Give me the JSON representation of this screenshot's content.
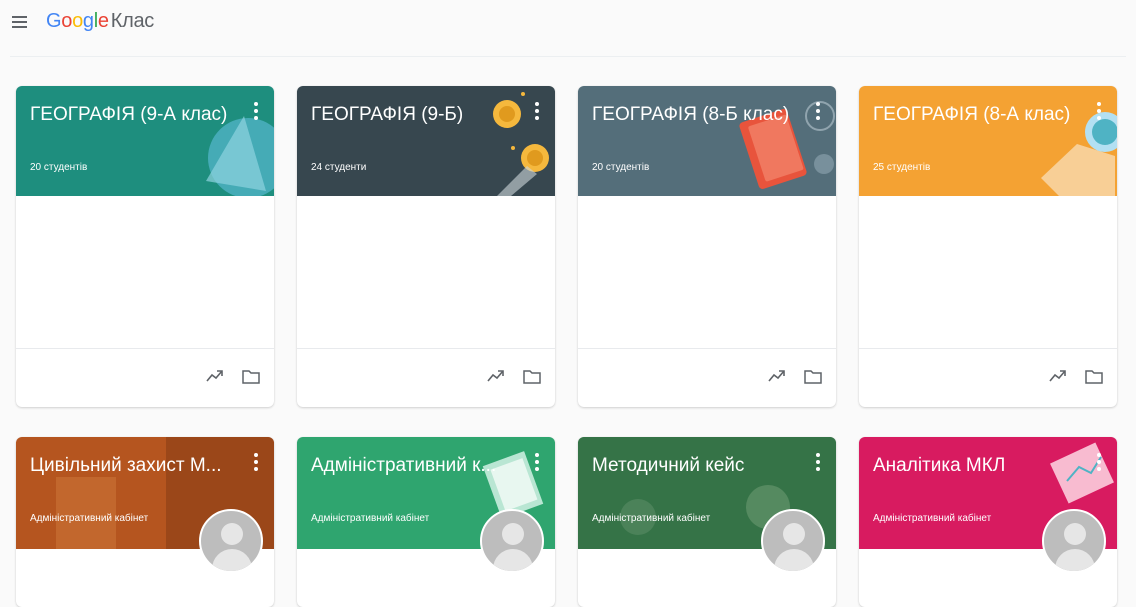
{
  "header": {
    "brand_google": "Google",
    "brand_product": "Клас"
  },
  "row1": [
    {
      "title": "ГЕОГРАФІЯ (9-А клас)",
      "subtitle": "20 студентів",
      "color": "#1e8e7e"
    },
    {
      "title": "ГЕОГРАФІЯ (9-Б)",
      "subtitle": "24 студенти",
      "color": "#37474f"
    },
    {
      "title": "ГЕОГРАФІЯ (8-Б клас)",
      "subtitle": "20 студентів",
      "color": "#546e7a"
    },
    {
      "title": "ГЕОГРАФІЯ (8-А клас)",
      "subtitle": "25 студентів",
      "color": "#f4a233"
    }
  ],
  "row2": [
    {
      "title": "Цивільний захист М...",
      "subtitle": "Адміністративний кабінет",
      "color": "#b5551f"
    },
    {
      "title": "Адміністративний к...",
      "subtitle": "Адміністративний кабінет",
      "color": "#2fa56f"
    },
    {
      "title": "Методичний кейс",
      "subtitle": "Адміністративний кабінет",
      "color": "#3c7a4e"
    },
    {
      "title": "Аналітика МКЛ",
      "subtitle": "Адміністративний кабінет",
      "color": "#d81b60"
    }
  ],
  "icons": {
    "menu": "hamburger-menu-icon",
    "more": "more-vert-icon",
    "stats": "trending-up-icon",
    "drive": "folder-icon",
    "avatar": "account-avatar-icon"
  }
}
